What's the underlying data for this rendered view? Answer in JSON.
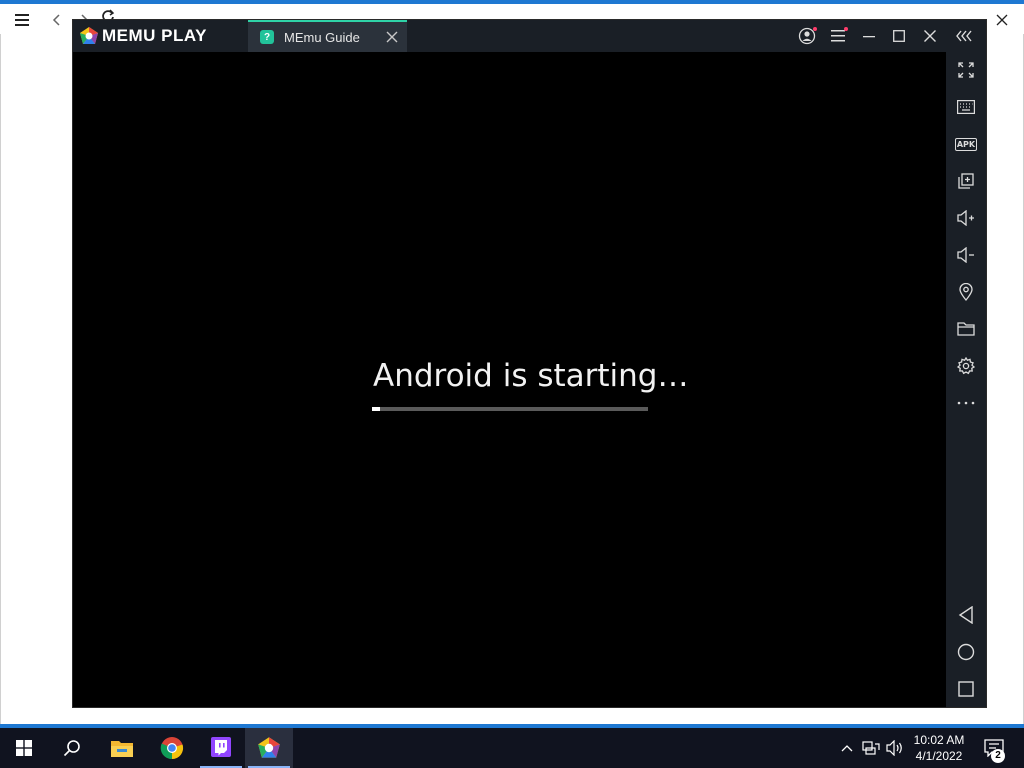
{
  "browser_toolbar": {
    "menu_icon": "hamburger-icon",
    "back_icon": "chevron-left-icon",
    "forward_icon": "chevron-right-icon",
    "refresh_icon": "refresh-icon"
  },
  "memu": {
    "logo_text": "MEMU PLAY",
    "tab": {
      "label": "MEmu Guide",
      "icon_glyph": "?"
    },
    "boot_message": "Android is starting…",
    "boot_progress": 0.03,
    "colors": {
      "accent": "#2fd3a7",
      "titlebar": "#1a1f26",
      "notification_dot": "#ff3d6b"
    },
    "sidebar_items": [
      "fullscreen-icon",
      "keyboard-icon",
      "apk-icon",
      "multi-instance-icon",
      "volume-up-icon",
      "volume-down-icon",
      "location-icon",
      "folder-icon",
      "settings-icon",
      "more-icon",
      "back-icon",
      "home-icon",
      "recents-icon"
    ],
    "apk_label": "APK"
  },
  "taskbar": {
    "apps": [
      "start-icon",
      "search-icon",
      "file-explorer-icon",
      "chrome-icon",
      "twitch-icon",
      "memu-icon"
    ],
    "time": "10:02 AM",
    "date": "4/1/2022",
    "notification_count": "2"
  }
}
